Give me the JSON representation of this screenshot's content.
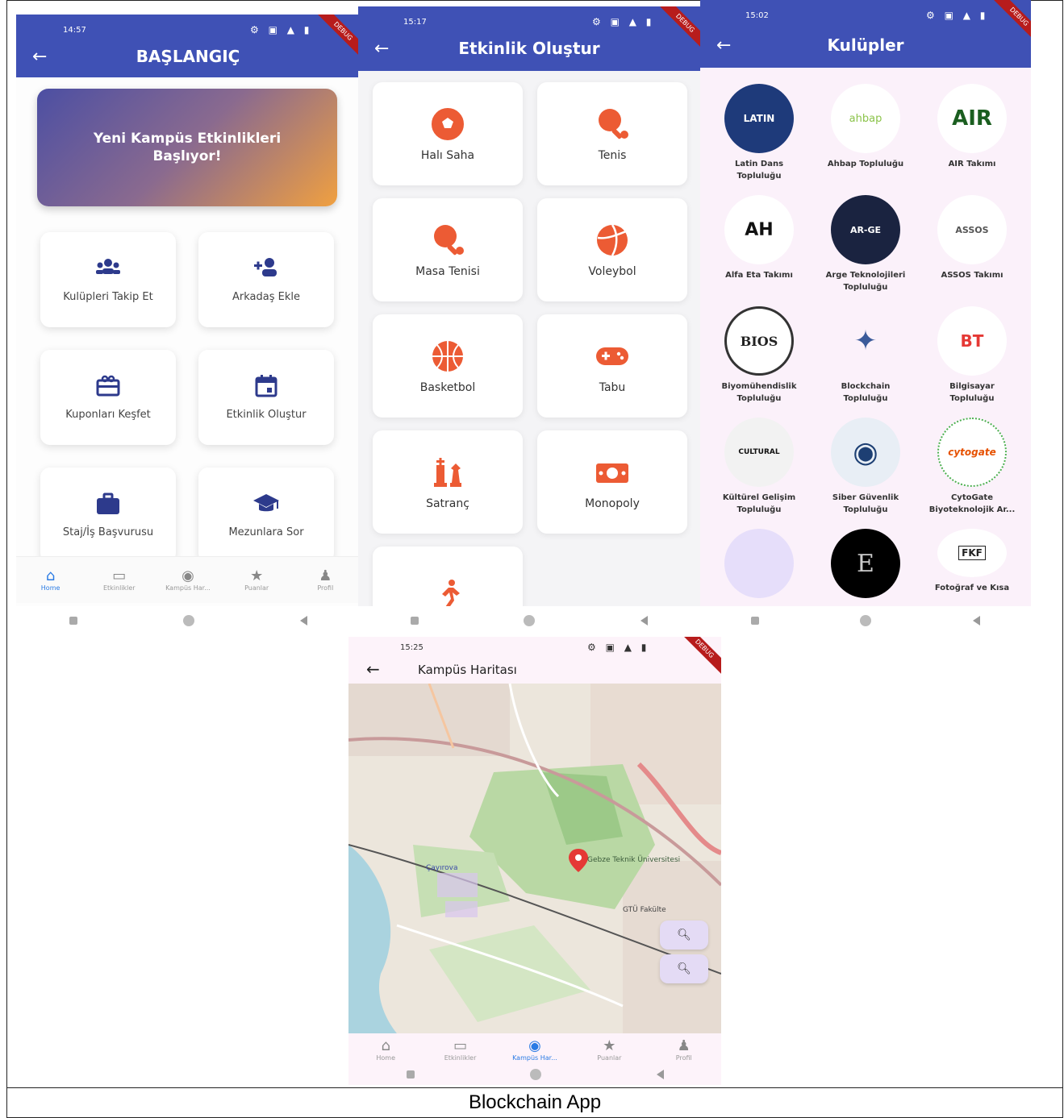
{
  "caption": "Blockchain App",
  "screen_home": {
    "time": "14:57",
    "title": "BAŞLANGIÇ",
    "banner": "Yeni Kampüs Etkinlikleri Başlıyor!",
    "tiles": [
      {
        "label": "Kulüpleri Takip Et",
        "icon": "group-icon"
      },
      {
        "label": "Arkadaş Ekle",
        "icon": "add-person-icon"
      },
      {
        "label": "Kuponları Keşfet",
        "icon": "gift-card-icon"
      },
      {
        "label": "Etkinlik Oluştur",
        "icon": "calendar-icon"
      },
      {
        "label": "Staj/İş Başvurusu",
        "icon": "briefcase-icon"
      },
      {
        "label": "Mezunlara Sor",
        "icon": "graduation-cap-icon"
      }
    ],
    "bottom_nav": [
      {
        "label": "Home",
        "icon": "home-icon",
        "active": true
      },
      {
        "label": "Etkinlikler",
        "icon": "calendar-icon",
        "active": false
      },
      {
        "label": "Kampüs Har...",
        "icon": "location-pin-icon",
        "active": false
      },
      {
        "label": "Puanlar",
        "icon": "star-icon",
        "active": false
      },
      {
        "label": "Profil",
        "icon": "person-icon",
        "active": false
      }
    ],
    "accent": "#2a7be4",
    "appbar_color": "#3f51b5"
  },
  "screen_create": {
    "time": "15:17",
    "title": "Etkinlik Oluştur",
    "sports": [
      {
        "label": "Halı Saha",
        "icon": "soccer-ball-icon"
      },
      {
        "label": "Tenis",
        "icon": "ping-pong-icon"
      },
      {
        "label": "Masa Tenisi",
        "icon": "ping-pong-icon"
      },
      {
        "label": "Voleybol",
        "icon": "volleyball-icon"
      },
      {
        "label": "Basketbol",
        "icon": "basketball-icon"
      },
      {
        "label": "Tabu",
        "icon": "gamepad-icon"
      },
      {
        "label": "Satranç",
        "icon": "chess-icon"
      },
      {
        "label": "Monopoly",
        "icon": "money-icon"
      },
      {
        "label": "",
        "icon": "running-icon"
      }
    ],
    "icon_color": "#ec5b34"
  },
  "screen_clubs": {
    "time": "15:02",
    "title": "Kulüpler",
    "clubs": [
      {
        "label": "Latin Dans\nTopluluğu",
        "logo_text": "LATIN"
      },
      {
        "label": "Ahbap Topluluğu",
        "logo_text": "ahbap"
      },
      {
        "label": "AIR Takımı",
        "logo_text": "AIR"
      },
      {
        "label": "Alfa Eta Takımı",
        "logo_text": "ΑΗ"
      },
      {
        "label": "Arge Teknolojileri\nTopluluğu",
        "logo_text": "AR-GE"
      },
      {
        "label": "ASSOS Takımı",
        "logo_text": "ASSOS"
      },
      {
        "label": "Biyomühendislik\nTopluluğu",
        "logo_text": "BIOS"
      },
      {
        "label": "Blockchain\nTopluluğu",
        "logo_text": "✦"
      },
      {
        "label": "Bilgisayar\nTopluluğu",
        "logo_text": "BT"
      },
      {
        "label": "Kültürel Gelişim\nTopluluğu",
        "logo_text": "CULTURAL"
      },
      {
        "label": "Siber Güvenlik\nTopluluğu",
        "logo_text": "◉"
      },
      {
        "label": "CytoGate\nBiyoteknolojik Ar...",
        "logo_text": "cytogate"
      },
      {
        "label": "",
        "logo_text": ""
      },
      {
        "label": "",
        "logo_text": "E"
      },
      {
        "label": "Fotoğraf ve Kısa",
        "logo_text": "FKF"
      }
    ]
  },
  "screen_map": {
    "time": "15:25",
    "title": "Kampüs Haritası",
    "map_labels": [
      "Gebze Teknik Üniversitesi",
      "Çayırova",
      "GTÜ Fakülte"
    ],
    "bottom_nav": [
      {
        "label": "Home",
        "icon": "home-icon",
        "active": false
      },
      {
        "label": "Etkinlikler",
        "icon": "calendar-icon",
        "active": false
      },
      {
        "label": "Kampüs Har...",
        "icon": "location-pin-icon",
        "active": true
      },
      {
        "label": "Puanlar",
        "icon": "star-icon",
        "active": false
      },
      {
        "label": "Profil",
        "icon": "person-icon",
        "active": false
      }
    ]
  }
}
